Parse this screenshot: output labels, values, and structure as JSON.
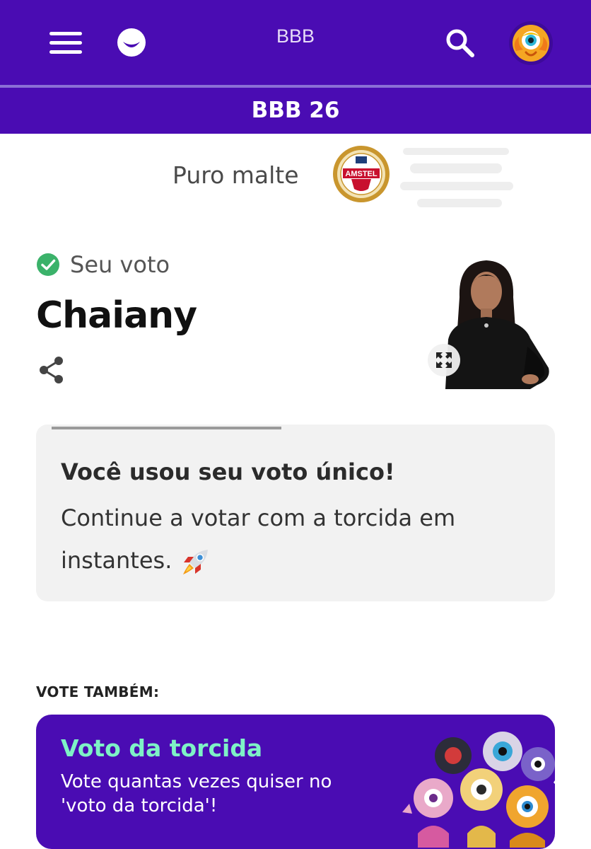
{
  "header": {
    "title": "BBB",
    "menu_icon": "hamburger-menu-icon",
    "logo_icon": "smile-logo-icon",
    "search_icon": "search-icon",
    "avatar_icon": "bbb-eye-avatar-icon",
    "background_color": "#4a0cb3"
  },
  "subheader": {
    "title": "BBB 26"
  },
  "sponsor": {
    "text": "Puro malte",
    "logo_text": "AMSTEL"
  },
  "vote": {
    "status_icon": "check-circle-icon",
    "label": "Seu voto",
    "candidate": "Chaiany",
    "share_icon": "share-icon",
    "expand_icon": "expand-icon"
  },
  "info_card": {
    "progress": 0.47,
    "title": "Você usou seu voto único!",
    "body": "Continue a votar com a torcida em instantes.",
    "emoji_icon": "rocket-icon"
  },
  "also_vote": {
    "label": "VOTE TAMBÉM:"
  },
  "torcida": {
    "title": "Voto da torcida",
    "description": "Vote quantas vezes quiser no 'voto da torcida'!",
    "title_color": "#7ef2c6"
  }
}
